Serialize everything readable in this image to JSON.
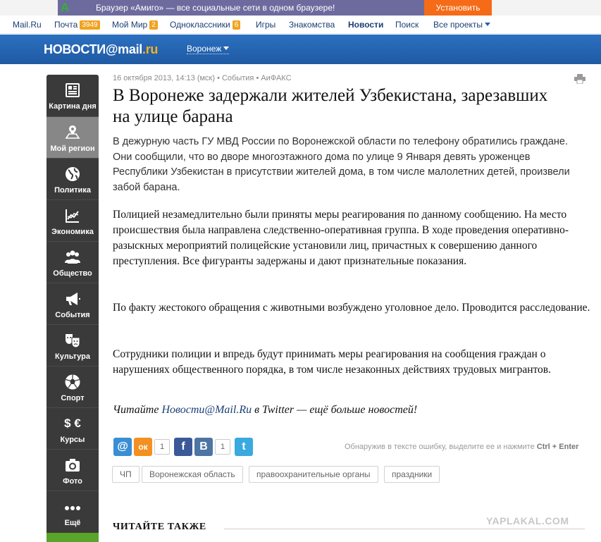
{
  "promo": {
    "logo": "A",
    "text": "Браузер «Амиго» — все социальные сети в одном браузере!",
    "button": "Установить"
  },
  "nav": {
    "items": [
      {
        "label": "Mail.Ru"
      },
      {
        "label": "Почта",
        "badge": "3949"
      },
      {
        "label": "Мой Мир",
        "badge": "2"
      },
      {
        "label": "Одноклассники",
        "badge": "6"
      },
      {
        "label": "Игры"
      },
      {
        "label": "Знакомства"
      },
      {
        "label": "Новости",
        "active": true
      },
      {
        "label": "Поиск"
      },
      {
        "label": "Все проекты"
      }
    ]
  },
  "header": {
    "logo_main": "НОВОСТИ@mail",
    "logo_tld": ".ru",
    "region": "Воронеж"
  },
  "sidebar": {
    "items": [
      {
        "label": "Картина дня",
        "icon": "newspaper-icon"
      },
      {
        "label": "Мой регион",
        "icon": "map-pin-icon",
        "active": true
      },
      {
        "label": "Политика",
        "icon": "globe-icon"
      },
      {
        "label": "Экономика",
        "icon": "chart-icon"
      },
      {
        "label": "Общество",
        "icon": "people-icon"
      },
      {
        "label": "События",
        "icon": "megaphone-icon"
      },
      {
        "label": "Культура",
        "icon": "theater-masks-icon"
      },
      {
        "label": "Спорт",
        "icon": "soccer-ball-icon"
      },
      {
        "label": "Курсы",
        "icon": "currency-icon",
        "glyph": "$ €"
      },
      {
        "label": "Фото",
        "icon": "camera-icon"
      },
      {
        "label": "Ещё",
        "icon": "more-dots-icon"
      }
    ]
  },
  "article": {
    "meta": "16 октября 2013, 14:13 (мск) • События • АиФАКС",
    "title": "В Воронеже задержали жителей Узбекистана, зарезавших на улице барана",
    "lead": "В дежурную часть ГУ МВД России по Воронежской области по телефону обратились граждане. Они сообщили, что во дворе многоэтажного дома по улице 9 Января девять уроженцев Республики Узбекистан в присутствии жителей дома, в том числе малолетних детей, произвели забой барана.",
    "paragraphs": [
      "Полицией незамедлительно были приняты меры реагирования по данному сообщению. На место происшествия была направлена следственно-оперативная группа. В ходе проведения оперативно-разыскных мероприятий полицейские установили лиц, причастных к совершению данного преступления. Все фигуранты задержаны и дают признательные показания.",
      "По факту жестокого обращения с животными возбуждено уголовное дело. Проводится расследование.",
      "Сотрудники полиции и впредь будут принимать меры реагирования на сообщения граждан о нарушениях общественного порядка, в том числе незаконных действиях трудовых мигрантов."
    ],
    "twitter_prefix": "Читайте ",
    "twitter_link": "Новости@Mail.Ru",
    "twitter_suffix": " в Twitter —  ещё больше новостей!"
  },
  "share": {
    "mailru_glyph": "@",
    "ok_glyph": "ок",
    "ok_count": "1",
    "fb_glyph": "f",
    "vk_glyph": "B",
    "vk_count": "1",
    "tw_glyph": "t",
    "colors": {
      "mailru": "#3a8ed4",
      "ok": "#f39022",
      "fb": "#3b5998",
      "vk": "#4d75a3",
      "tw": "#39a9e0"
    }
  },
  "error_hint": {
    "text": "Обнаружив в тексте ошибку, выделите ее и нажмите ",
    "keys": "Ctrl + Enter"
  },
  "tags": [
    "ЧП",
    "Воронежская область",
    "правоохранительные органы",
    "праздники"
  ],
  "watermark": "YAPLAKAL.COM",
  "read_also": "ЧИТАЙТЕ ТАКЖЕ"
}
